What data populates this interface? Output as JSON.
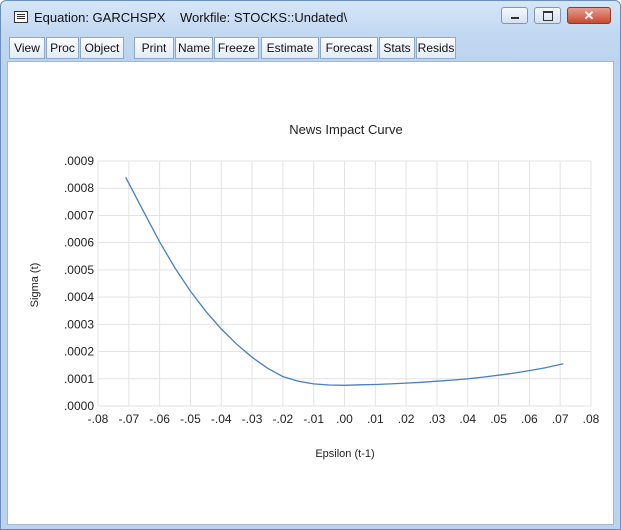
{
  "window": {
    "title": "Equation: GARCHSPX    Workfile: STOCKS::Undated\\",
    "icon": "equation-window-icon",
    "controls": {
      "minimize_icon": "minimize-icon",
      "maximize_icon": "maximize-icon",
      "close_icon": "close-icon",
      "close_glyph": "✕"
    }
  },
  "toolbar": {
    "buttons": [
      "View",
      "Proc",
      "Object",
      "Print",
      "Name",
      "Freeze",
      "Estimate",
      "Forecast",
      "Stats",
      "Resids"
    ]
  },
  "chart_data": {
    "type": "line",
    "title": "News Impact Curve",
    "xlabel": "Epsilon (t-1)",
    "ylabel": "Sigma (t)",
    "xlim": [
      -0.08,
      0.08
    ],
    "ylim": [
      0,
      0.0009
    ],
    "x_tick_labels": [
      "-.08",
      "-.07",
      "-.06",
      "-.05",
      "-.04",
      "-.03",
      "-.02",
      "-.01",
      ".00",
      ".01",
      ".02",
      ".03",
      ".04",
      ".05",
      ".06",
      ".07",
      ".08"
    ],
    "y_tick_labels": [
      ".0000",
      ".0001",
      ".0002",
      ".0003",
      ".0004",
      ".0005",
      ".0006",
      ".0007",
      ".0008",
      ".0009"
    ],
    "grid": true,
    "line_color": "#4a7fc1",
    "series": [
      {
        "x": [
          -0.071,
          -0.065,
          -0.06,
          -0.055,
          -0.05,
          -0.045,
          -0.04,
          -0.035,
          -0.03,
          -0.025,
          -0.02,
          -0.015,
          -0.01,
          -0.005,
          0.0,
          0.005,
          0.01,
          0.015,
          0.02,
          0.025,
          0.03,
          0.035,
          0.04,
          0.045,
          0.05,
          0.055,
          0.06,
          0.065,
          0.071
        ],
        "y": [
          0.00084,
          0.00071,
          0.000603,
          0.000507,
          0.000422,
          0.000348,
          0.000283,
          0.000227,
          0.000179,
          0.000139,
          0.000108,
          9.1e-05,
          8.1e-05,
          7.7e-05,
          7.6e-05,
          7.8e-05,
          7.9e-05,
          8.1e-05,
          8.4e-05,
          8.7e-05,
          9.1e-05,
          9.5e-05,
          0.0001,
          0.000106,
          0.000113,
          0.000121,
          0.00013,
          0.00014,
          0.000155
        ]
      }
    ]
  }
}
